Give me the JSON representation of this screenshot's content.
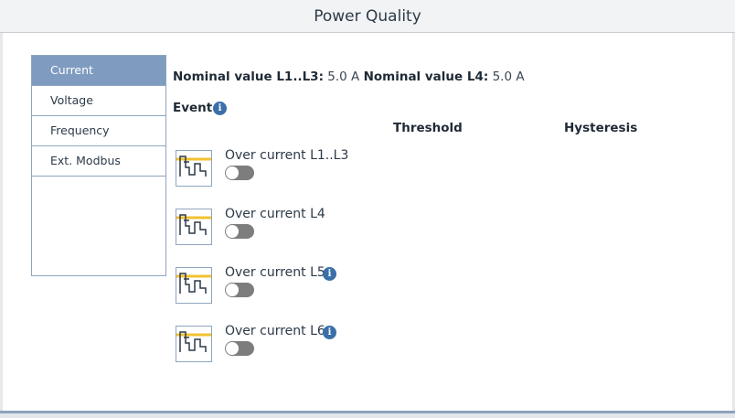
{
  "window": {
    "title": "Power Quality"
  },
  "sidebar": {
    "items": [
      {
        "label": "Current",
        "active": true
      },
      {
        "label": "Voltage",
        "active": false
      },
      {
        "label": "Frequency",
        "active": false
      },
      {
        "label": "Ext. Modbus",
        "active": false
      }
    ]
  },
  "nominal": {
    "l1l3_label": "Nominal value L1..L3:",
    "l1l3_value": "5.0 A",
    "l4_label": "Nominal value L4:",
    "l4_value": "5.0 A"
  },
  "events": {
    "heading": "Event",
    "columns": {
      "threshold": "Threshold",
      "hysteresis": "Hysteresis"
    },
    "rows": [
      {
        "label": "Over current L1..L3",
        "has_info": false,
        "enabled": false
      },
      {
        "label": "Over current L4",
        "has_info": false,
        "enabled": false
      },
      {
        "label": "Over current L5",
        "has_info": true,
        "enabled": false
      },
      {
        "label": "Over current L6",
        "has_info": true,
        "enabled": false
      }
    ]
  },
  "icons": {
    "info": "info-icon",
    "waveform": "overcurrent-waveform-icon"
  },
  "colors": {
    "accent": "#7f9cc0",
    "info": "#3a6fa8",
    "toggle_off": "#7d7d7d",
    "threshold_line": "#f2c230",
    "waveform": "#2c3a48"
  }
}
